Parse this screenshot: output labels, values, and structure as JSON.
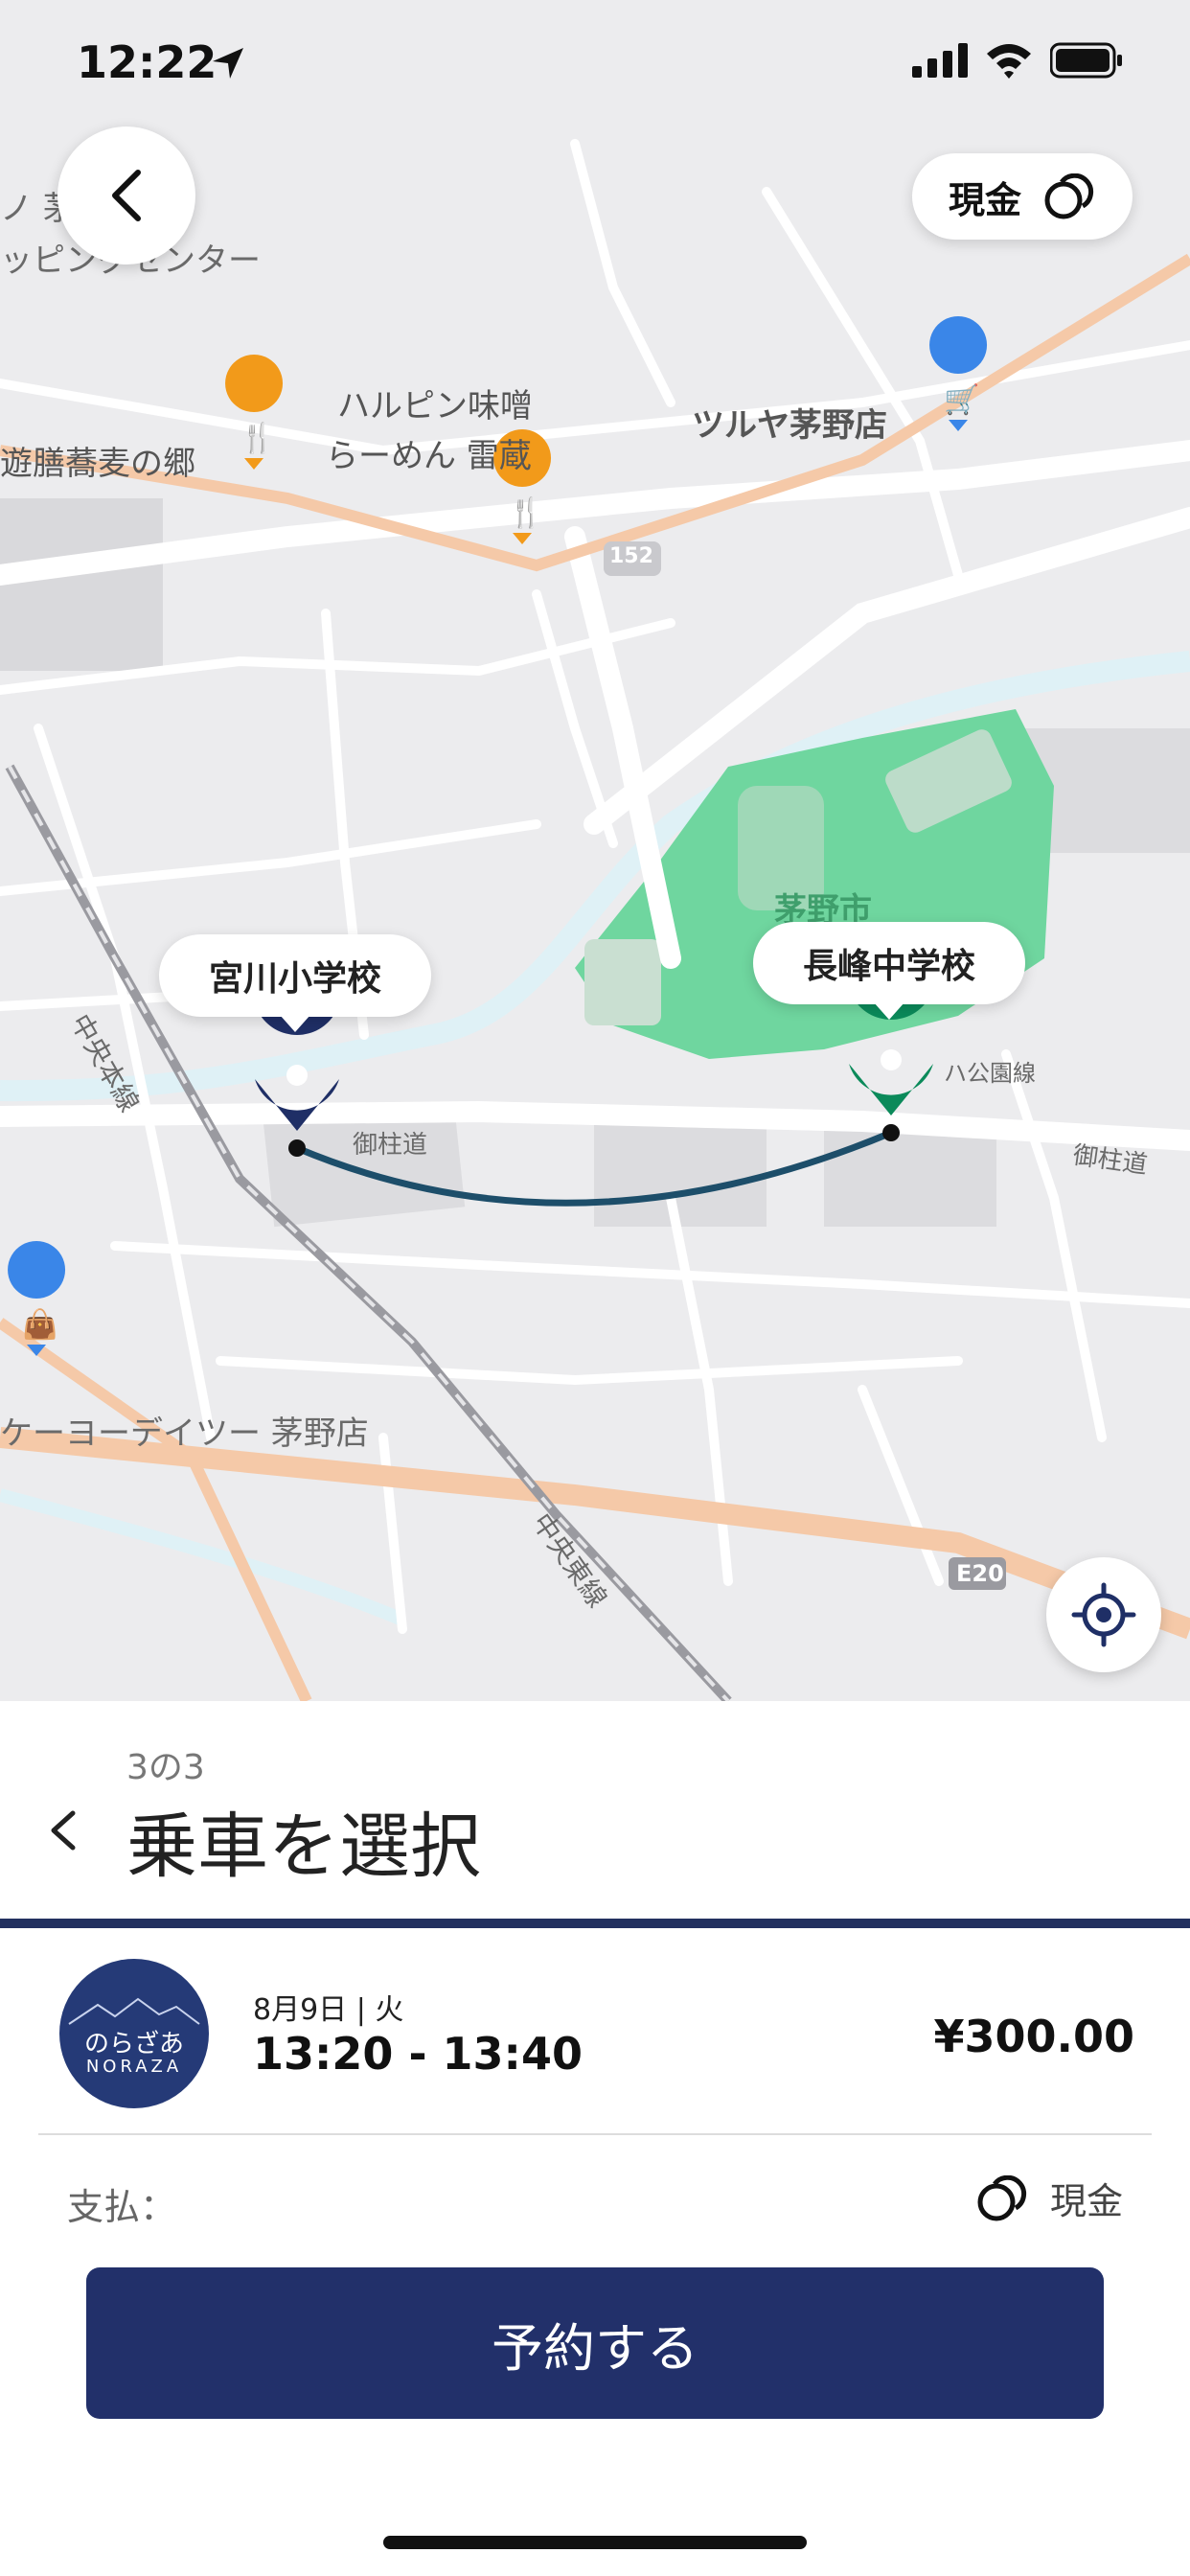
{
  "status_bar": {
    "time": "12:22"
  },
  "map": {
    "payment_pill_label": "現金",
    "labels": {
      "shopping_center": "ッピングセンター",
      "shopping_center_top": "ノ 茅",
      "harbin_line1": "ハルピン味噌",
      "harbin_line2": "らーめん 雷蔵",
      "tsuruya": "ツルヤ茅野店",
      "soba": "遊膳蕎麦の郷",
      "road_152": "152",
      "chino_city": "茅野市",
      "chuo_line_left": "中央本線",
      "chuo_line_bottom": "中央東線",
      "onbashira_left": "御柱道",
      "onbashira_right": "御柱道",
      "park_line": "ハ公園線",
      "keiyo": "ケーヨーデイツー 茅野店",
      "e20": "E20"
    },
    "pickup_name": "宮川小学校",
    "dropoff_name": "長峰中学校",
    "colors": {
      "pickup": "#1f2f66",
      "dropoff": "#0b8a5a",
      "park": "#6fd69f"
    }
  },
  "sheet": {
    "step": "3の3",
    "title": "乗車を選択",
    "ride": {
      "logo_line1": "のらざあ",
      "logo_line2": "NORAZA",
      "date": "8月9日 | 火",
      "time_range": "13:20 - 13:40",
      "price": "¥300.00"
    },
    "payment_label": "支払：",
    "payment_method": "現金",
    "reserve_button": "予約する"
  }
}
